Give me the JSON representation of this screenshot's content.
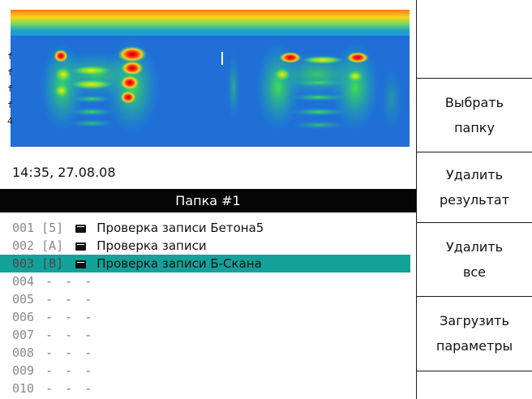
{
  "timestamp": "14:35, 27.08.08",
  "folder_title": "Папка #1",
  "edge_glyphs": [
    "f",
    "f",
    "f",
    "f",
    "4"
  ],
  "files": [
    {
      "num": "001",
      "tag": "[5]",
      "title": "Проверка записи Бетона5",
      "selected": false
    },
    {
      "num": "002",
      "tag": "[A]",
      "title": "Проверка записи",
      "selected": false
    },
    {
      "num": "003",
      "tag": "[B]",
      "title": "Проверка записи Б-Скана",
      "selected": true
    },
    {
      "num": "004",
      "empty": "- - -"
    },
    {
      "num": "005",
      "empty": "- - -"
    },
    {
      "num": "006",
      "empty": "- - -"
    },
    {
      "num": "007",
      "empty": "- - -"
    },
    {
      "num": "008",
      "empty": "- - -"
    },
    {
      "num": "009",
      "empty": "- - -"
    },
    {
      "num": "010",
      "empty": "- - -"
    }
  ],
  "sidebar": {
    "select_folder": [
      "Выбрать",
      "папку"
    ],
    "delete_result": [
      "Удалить",
      "результат"
    ],
    "delete_all": [
      "Удалить",
      "все"
    ],
    "load_params": [
      "Загрузить",
      "параметры"
    ]
  },
  "colors": {
    "selected_row": "#14a19a",
    "header_bg": "#050505",
    "spectrogram_bg": "#1f6fd6"
  }
}
